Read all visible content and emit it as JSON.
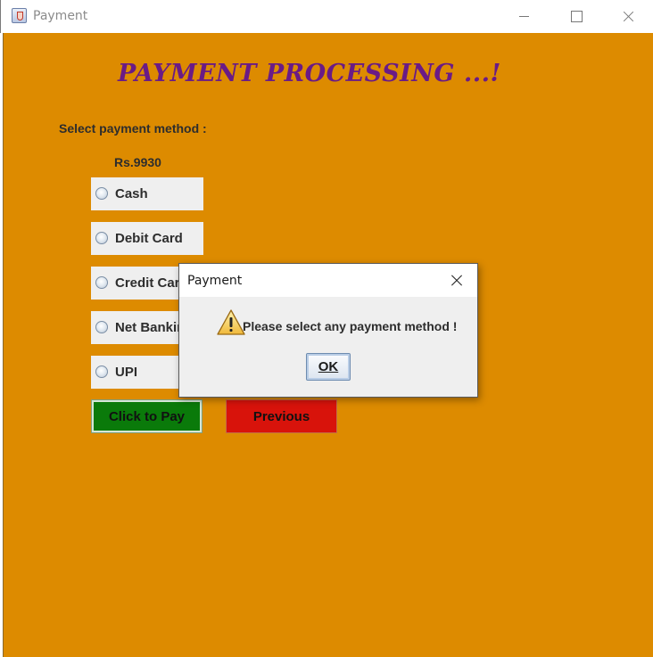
{
  "window": {
    "title": "Payment",
    "icon": "java-cup-icon"
  },
  "main": {
    "heading": "PAYMENT PROCESSING ...!",
    "select_label": "Select payment method :",
    "amount": "Rs.9930",
    "options": [
      {
        "label": "Cash",
        "selected": false
      },
      {
        "label": "Debit Card",
        "selected": false
      },
      {
        "label": "Credit Card",
        "selected": false
      },
      {
        "label": "Net Banking",
        "selected": false
      },
      {
        "label": "UPI",
        "selected": false
      }
    ],
    "pay_button": "Click to Pay",
    "previous_button": "Previous"
  },
  "dialog": {
    "title": "Payment",
    "message": "Please select any payment method !",
    "ok_button": "OK",
    "icon": "warning-icon"
  },
  "colors": {
    "background": "#dd8b00",
    "heading": "#6a1b86",
    "pay_button": "#0a7a0a",
    "previous_button": "#d8130b"
  }
}
